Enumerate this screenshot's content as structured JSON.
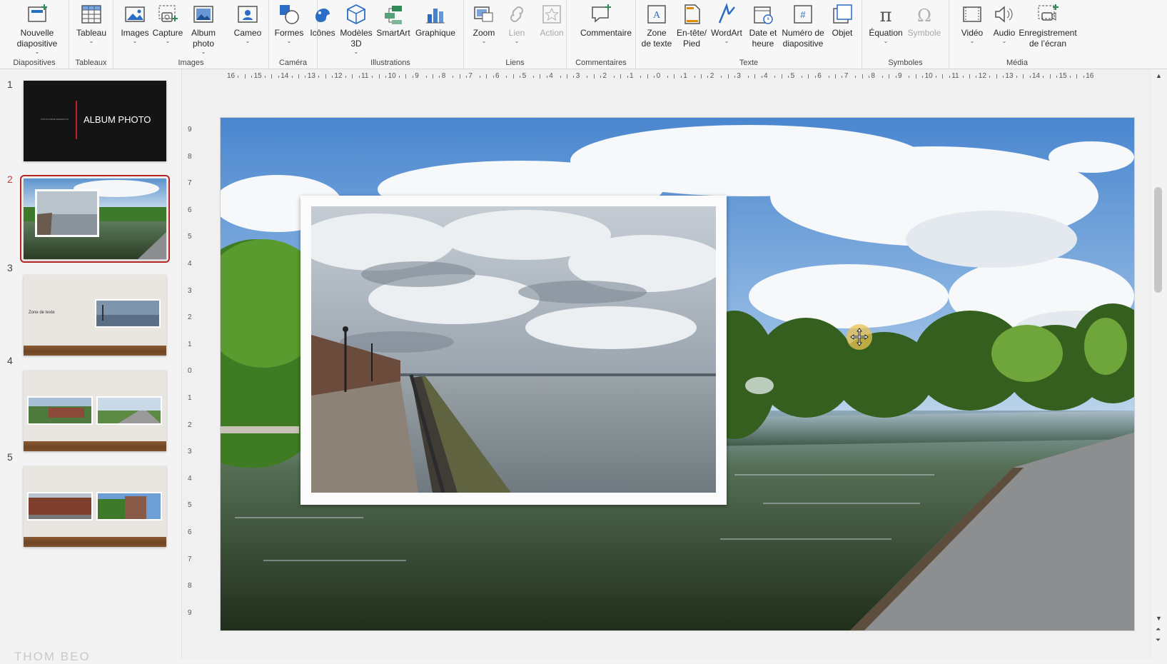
{
  "ribbon": {
    "groups": [
      {
        "label": "Diapositives",
        "buttons": [
          {
            "label": "Nouvelle\ndiapositive",
            "icon": "new-slide-icon",
            "caret": true
          }
        ]
      },
      {
        "label": "Tableaux",
        "buttons": [
          {
            "label": "Tableau",
            "icon": "table-icon",
            "caret": true
          }
        ]
      },
      {
        "label": "Images",
        "buttons": [
          {
            "label": "Images",
            "icon": "images-icon",
            "caret": true
          },
          {
            "label": "Capture",
            "icon": "screenshot-icon",
            "caret": true
          },
          {
            "label": "Album\nphoto",
            "icon": "photo-album-icon",
            "caret": true
          }
        ]
      },
      {
        "label": "Caméra",
        "buttons": [
          {
            "label": "Cameo",
            "icon": "cameo-icon",
            "caret": true
          }
        ]
      },
      {
        "label": "Illustrations",
        "buttons": [
          {
            "label": "Formes",
            "icon": "shapes-icon",
            "caret": true
          },
          {
            "label": "Icônes",
            "icon": "icons-icon",
            "caret": false
          },
          {
            "label": "Modèles\n3D",
            "icon": "3d-models-icon",
            "caret": true
          },
          {
            "label": "SmartArt",
            "icon": "smartart-icon",
            "caret": false
          },
          {
            "label": "Graphique",
            "icon": "chart-icon",
            "caret": false
          }
        ]
      },
      {
        "label": "Liens",
        "buttons": [
          {
            "label": "Zoom",
            "icon": "zoom-icon",
            "caret": true
          },
          {
            "label": "Lien",
            "icon": "link-icon",
            "caret": true,
            "disabled": true
          },
          {
            "label": "Action",
            "icon": "action-icon",
            "caret": false,
            "disabled": true
          }
        ]
      },
      {
        "label": "Commentaires",
        "buttons": [
          {
            "label": "Commentaire",
            "icon": "comment-icon",
            "caret": false
          }
        ]
      },
      {
        "label": "Texte",
        "buttons": [
          {
            "label": "Zone\nde texte",
            "icon": "text-box-icon",
            "caret": false
          },
          {
            "label": "En-tête/\nPied",
            "icon": "header-footer-icon",
            "caret": false
          },
          {
            "label": "WordArt",
            "icon": "wordart-icon",
            "caret": true
          },
          {
            "label": "Date et\nheure",
            "icon": "date-time-icon",
            "caret": false
          },
          {
            "label": "Numéro de\ndiapositive",
            "icon": "slide-number-icon",
            "caret": false
          },
          {
            "label": "Objet",
            "icon": "object-icon",
            "caret": false
          }
        ]
      },
      {
        "label": "Symboles",
        "buttons": [
          {
            "label": "Équation",
            "icon": "equation-icon",
            "caret": true
          },
          {
            "label": "Symbole",
            "icon": "symbol-icon",
            "caret": false,
            "disabled": true
          }
        ]
      },
      {
        "label": "Média",
        "buttons": [
          {
            "label": "Vidéo",
            "icon": "video-icon",
            "caret": true
          },
          {
            "label": "Audio",
            "icon": "audio-icon",
            "caret": true
          },
          {
            "label": "Enregistrement\nde l’écran",
            "icon": "screen-recording-icon",
            "caret": false
          }
        ]
      }
    ]
  },
  "slides": [
    {
      "number": "1",
      "title": "ALBUM PHOTO",
      "subtitle": "PORTUGUESE BENEDICTS",
      "kind": "title"
    },
    {
      "number": "2",
      "kind": "photo",
      "selected": true
    },
    {
      "number": "3",
      "kind": "text-photo",
      "text": "Zone de texte"
    },
    {
      "number": "4",
      "kind": "two-photos"
    },
    {
      "number": "5",
      "kind": "two-photos"
    }
  ],
  "ruler": {
    "horizontal": [
      "16",
      "15",
      "14",
      "13",
      "12",
      "11",
      "10",
      "9",
      "8",
      "7",
      "6",
      "5",
      "4",
      "3",
      "2",
      "1",
      "0",
      "1",
      "2",
      "3",
      "4",
      "5",
      "6",
      "7",
      "8",
      "9",
      "10",
      "11",
      "12",
      "13",
      "14",
      "15",
      "16"
    ],
    "vertical": [
      "9",
      "8",
      "7",
      "6",
      "5",
      "4",
      "3",
      "2",
      "1",
      "0",
      "1",
      "2",
      "3",
      "4",
      "5",
      "6",
      "7",
      "8",
      "9"
    ]
  },
  "watermark": "THOM BEO",
  "colors": {
    "accent": "#b52424",
    "ribbon_bg": "#f7f7f7",
    "icon_blue": "#2b6cc4",
    "icon_green": "#2e8b57"
  }
}
